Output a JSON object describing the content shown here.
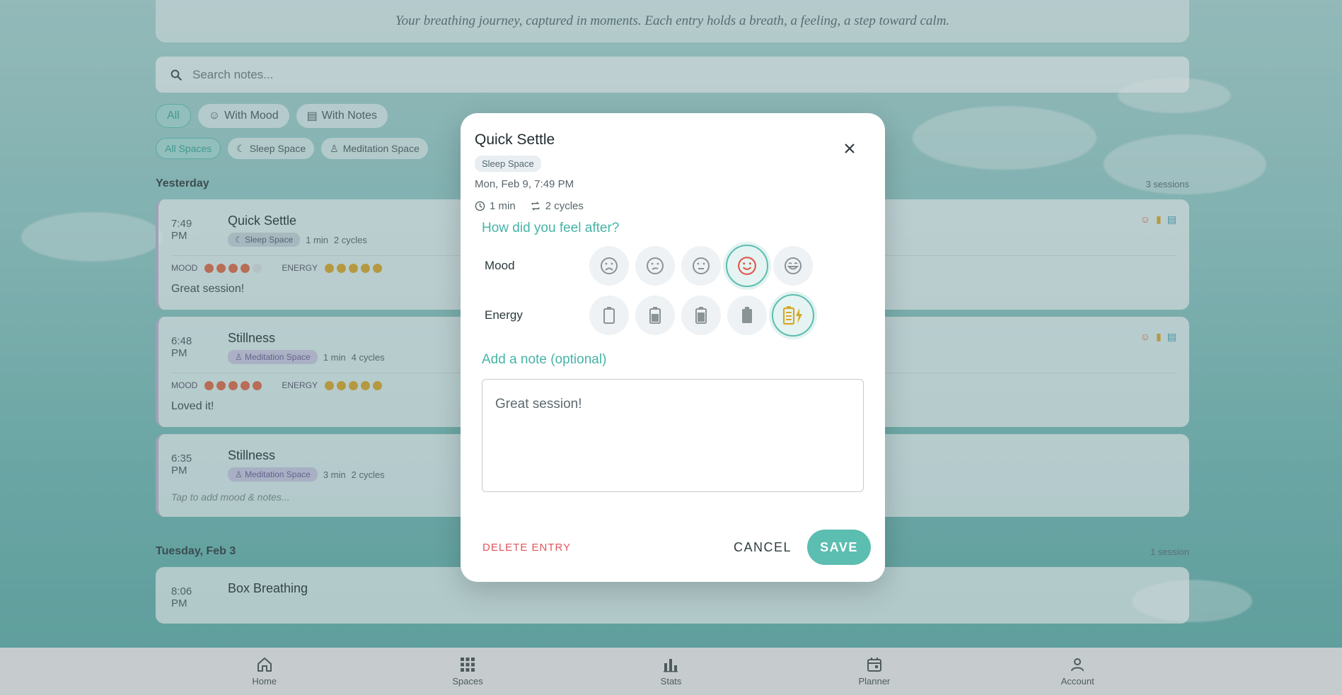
{
  "intro": {
    "text": "Your breathing journey, captured in moments. Each entry holds a breath, a feeling, a step toward calm."
  },
  "search": {
    "placeholder": "Search notes..."
  },
  "filters": {
    "all": "All",
    "with_mood": "With Mood",
    "with_notes": "With Notes"
  },
  "space_filters": {
    "all": "All Spaces",
    "sleep": "Sleep Space",
    "meditation": "Meditation Space"
  },
  "groups": [
    {
      "day": "Yesterday",
      "count": "3 sessions",
      "entries": [
        {
          "time": "7:49 PM",
          "title": "Quick Settle",
          "space": "Sleep Space",
          "duration": "1 min",
          "cycles": "2 cycles",
          "mood_label": "MOOD",
          "energy_label": "ENERGY",
          "mood": 4,
          "energy": 5,
          "note": "Great session!"
        },
        {
          "time": "6:48 PM",
          "title": "Stillness",
          "space": "Meditation Space",
          "duration": "1 min",
          "cycles": "4 cycles",
          "mood_label": "MOOD",
          "energy_label": "ENERGY",
          "mood": 5,
          "energy": 5,
          "note": "Loved it!"
        },
        {
          "time": "6:35 PM",
          "title": "Stillness",
          "space": "Meditation Space",
          "duration": "3 min",
          "cycles": "2 cycles",
          "note_placeholder": "Tap to add mood & notes..."
        }
      ]
    },
    {
      "day": "Tuesday, Feb 3",
      "count": "1 session",
      "entries": [
        {
          "time": "8:06 PM",
          "title": "Box Breathing"
        }
      ]
    }
  ],
  "nav": {
    "home": "Home",
    "spaces": "Spaces",
    "stats": "Stats",
    "planner": "Planner",
    "account": "Account"
  },
  "dialog": {
    "title": "Quick Settle",
    "space": "Sleep Space",
    "date": "Mon, Feb 9, 7:49 PM",
    "duration": "1 min",
    "cycles": "2 cycles",
    "feel_title": "How did you feel after?",
    "mood_label": "Mood",
    "energy_label": "Energy",
    "mood_selected": 4,
    "energy_selected": 5,
    "note_title": "Add a note (optional)",
    "note_value": "Great session!",
    "delete_label": "DELETE ENTRY",
    "cancel_label": "CANCEL",
    "save_label": "SAVE"
  },
  "colors": {
    "accent": "#5cbdb1",
    "mood": "#dd6a47",
    "energy": "#d9a72a",
    "danger": "#e0555b"
  }
}
